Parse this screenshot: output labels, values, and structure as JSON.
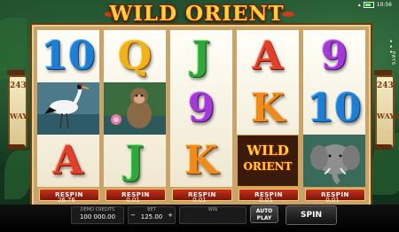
{
  "game": {
    "title": "WILD ORIENT",
    "status_bar": {
      "time": "10:56"
    },
    "side_menu": {
      "pays_label": "PAYS"
    },
    "ways_panels": {
      "number": "243",
      "label": "WAYS"
    },
    "reels": [
      {
        "symbols": [
          "10",
          "crane",
          "A"
        ],
        "respin_label": "RESPIN",
        "value": "26.76"
      },
      {
        "symbols": [
          "Q",
          "monkey",
          "J"
        ],
        "respin_label": "RESPIN",
        "value": "0.01"
      },
      {
        "symbols": [
          "J",
          "9",
          "K"
        ],
        "respin_label": "RESPIN",
        "value": "0.01"
      },
      {
        "symbols": [
          "A",
          "K",
          "wild"
        ],
        "respin_label": "RESPIN",
        "value": "0.01"
      },
      {
        "symbols": [
          "9",
          "10",
          "elephant"
        ],
        "respin_label": "RESPIN",
        "value": "0.01"
      }
    ],
    "wild_symbol": {
      "line1": "WILD",
      "line2": "ORIENT"
    },
    "bottom_bar": {
      "credits_label": "DEMO CREDITS",
      "credits_value": "100 000.00",
      "bet_label": "BET",
      "bet_value": "125.00",
      "win_label": "WIN",
      "win_value": "",
      "autoplay_label_1": "AUTO",
      "autoplay_label_2": "PLAY",
      "spin_label": "SPIN",
      "minus": "−",
      "plus": "+"
    },
    "colors": {
      "accent_gold": "#ffd23a",
      "respin_red": "#c8321c",
      "frame": "#c9a46a"
    }
  }
}
